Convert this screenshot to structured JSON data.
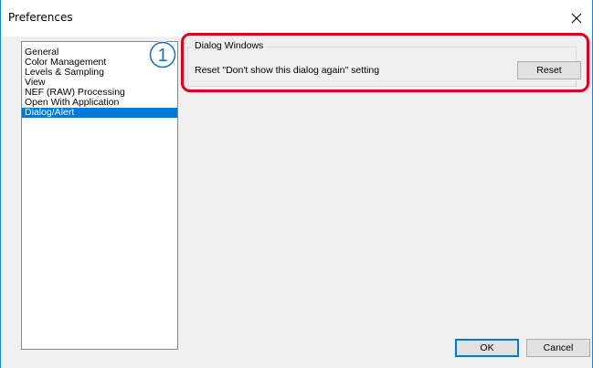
{
  "window": {
    "title": "Preferences"
  },
  "sidebar": {
    "items": [
      {
        "label": "General"
      },
      {
        "label": "Color Management"
      },
      {
        "label": "Levels & Sampling"
      },
      {
        "label": "View"
      },
      {
        "label": "NEF (RAW) Processing"
      },
      {
        "label": "Open With Application"
      },
      {
        "label": "Dialog/Alert",
        "selected": true
      }
    ]
  },
  "callout": {
    "number": "1"
  },
  "panel": {
    "group_title": "Dialog Windows",
    "reset_setting_label": "Reset \"Don't show this dialog again\" setting",
    "reset_button_label": "Reset"
  },
  "footer": {
    "ok_label": "OK",
    "cancel_label": "Cancel"
  },
  "colors": {
    "accent": "#0078d7",
    "highlight": "#e0001b",
    "window_border": "#1883d7"
  }
}
